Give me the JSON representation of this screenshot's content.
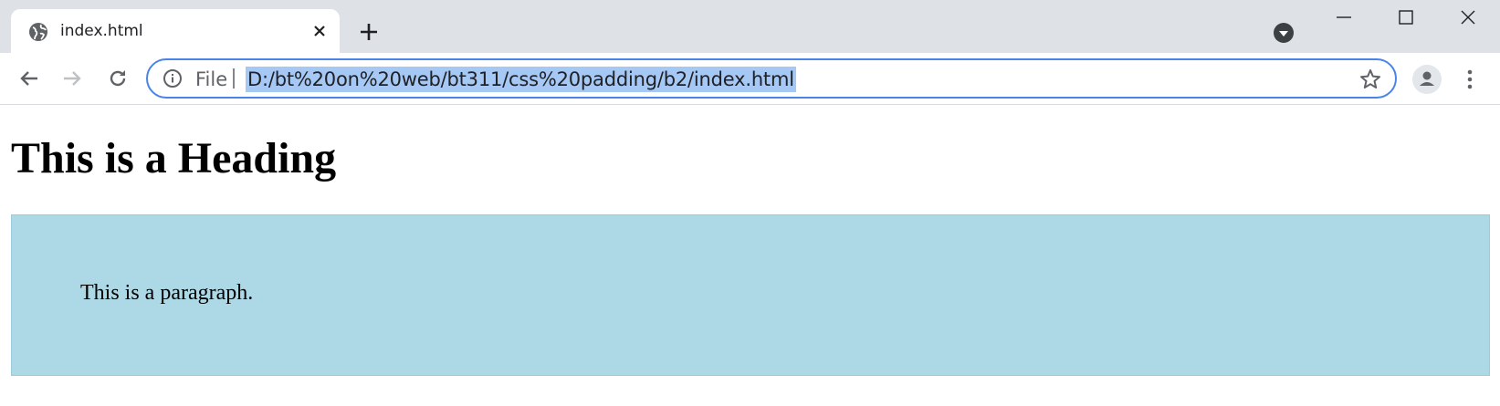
{
  "tab": {
    "title": "index.html"
  },
  "address_bar": {
    "scheme_label": "File",
    "url": "D:/bt%20on%20web/bt311/css%20padding/b2/index.html"
  },
  "page": {
    "heading": "This is a Heading",
    "paragraph": "This is a paragraph."
  },
  "colors": {
    "tabstrip": "#dee1e6",
    "omnibox_focus": "#4a84e8",
    "url_selection": "#a6c8f5",
    "paragraph_background": "#add8e6"
  },
  "icons": [
    "globe-icon",
    "close-icon",
    "plus-icon",
    "tab-search-icon",
    "minimize-icon",
    "maximize-icon",
    "window-close-icon",
    "back-arrow-icon",
    "forward-arrow-icon",
    "reload-icon",
    "info-icon",
    "star-icon",
    "profile-icon",
    "kebab-menu-icon"
  ]
}
